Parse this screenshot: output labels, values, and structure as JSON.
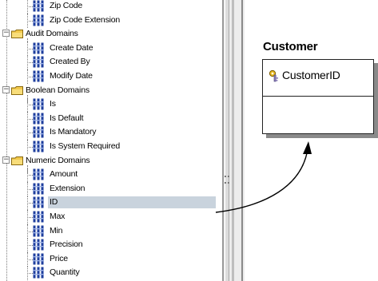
{
  "tree": {
    "rows": [
      {
        "kind": "item",
        "label": "Zip Code"
      },
      {
        "kind": "item",
        "label": "Zip Code Extension"
      },
      {
        "kind": "folder",
        "label": "Audit Domains"
      },
      {
        "kind": "item",
        "label": "Create Date"
      },
      {
        "kind": "item",
        "label": "Created By"
      },
      {
        "kind": "item",
        "label": "Modify Date"
      },
      {
        "kind": "folder",
        "label": "Boolean Domains"
      },
      {
        "kind": "item",
        "label": "Is"
      },
      {
        "kind": "item",
        "label": "Is Default"
      },
      {
        "kind": "item",
        "label": "Is Mandatory"
      },
      {
        "kind": "item",
        "label": "Is System Required"
      },
      {
        "kind": "folder",
        "label": "Numeric Domains"
      },
      {
        "kind": "item",
        "label": "Amount"
      },
      {
        "kind": "item",
        "label": "Extension"
      },
      {
        "kind": "item",
        "label": "ID",
        "selected": true
      },
      {
        "kind": "item",
        "label": "Max"
      },
      {
        "kind": "item",
        "label": "Min"
      },
      {
        "kind": "item",
        "label": "Precision"
      },
      {
        "kind": "item",
        "label": "Price"
      },
      {
        "kind": "item",
        "label": "Quantity"
      }
    ],
    "expander_symbol": "−",
    "icons": {
      "folder": "folder-icon",
      "item": "domain-icon"
    }
  },
  "entity": {
    "title": "Customer",
    "key_attribute": "CustomerID",
    "key_icon": "key-icon"
  },
  "colors": {
    "selection": "#c9d3dd",
    "folder_yellow": "#f2c94c",
    "domain_blue": "#1f3f9e",
    "connector": "#000000"
  }
}
